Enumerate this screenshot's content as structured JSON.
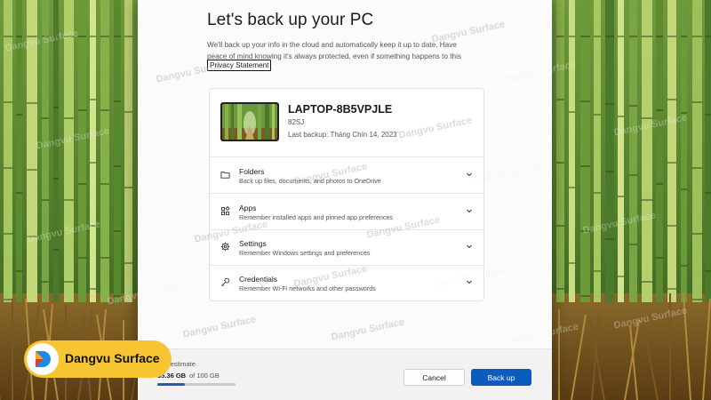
{
  "dialog": {
    "title": "Let's back up your PC",
    "description": "We'll back up your info in the cloud and automatically keep it up to date. Have peace of mind knowing it's always protected, even if something happens to this PC.",
    "privacy_link": "Privacy Statement"
  },
  "device": {
    "name": "LAPTOP-8B5VPJLE",
    "model": "82SJ",
    "last_backup": "Last backup: Tháng Chín 14, 2023"
  },
  "backup_items": [
    {
      "icon": "folder-icon",
      "title": "Folders",
      "subtitle": "Back up files, documents, and photos to OneDrive"
    },
    {
      "icon": "apps-icon",
      "title": "Apps",
      "subtitle": "Remember installed apps and pinned app preferences"
    },
    {
      "icon": "gear-icon",
      "title": "Settings",
      "subtitle": "Remember Windows settings and preferences"
    },
    {
      "icon": "key-icon",
      "title": "Credentials",
      "subtitle": "Remember Wi-Fi networks and other passwords"
    }
  ],
  "footer": {
    "storage_label": "age estimate",
    "storage_used": "35.36 GB",
    "storage_total": "of 100 GB",
    "storage_fraction": 0.3536,
    "cancel_label": "Cancel",
    "primary_label": "Back up"
  },
  "watermark": "Dangvu Surface",
  "brand": {
    "name": "Dangvu Surface",
    "color": "#f7c531"
  },
  "colors": {
    "accent": "#0b5cbd",
    "progress": "#1a5fb4"
  }
}
